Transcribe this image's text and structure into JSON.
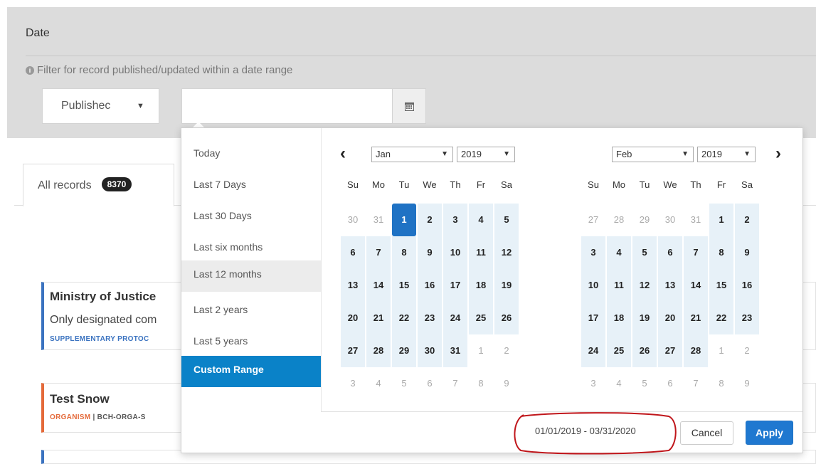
{
  "filter": {
    "title": "Date",
    "hint": "Filter for record published/updated within a date range",
    "type_select_value": "Publishec",
    "date_input_value": ""
  },
  "records": {
    "tab_all_label": "All records",
    "tab_all_count": "8370",
    "items": [
      {
        "title": "Ministry of Justice",
        "subtitle": "Only designated com",
        "tag": "SUPPLEMENTARY PROTOC"
      },
      {
        "title": "Test Snow",
        "tag_type": "ORGANISM",
        "tag_sep": " | ",
        "tag_rest": "BCH-ORGA-S"
      }
    ]
  },
  "picker": {
    "ranges": [
      "Today",
      "Last 7 Days",
      "Last 30 Days",
      "Last six months",
      "Last 12 months",
      "Last 2 years",
      "Last 5 years",
      "Custom Range"
    ],
    "hover_range": "Last 12 months",
    "active_range": "Custom Range",
    "dow": [
      "Su",
      "Mo",
      "Tu",
      "We",
      "Th",
      "Fr",
      "Sa"
    ],
    "left_month": "Jan",
    "left_year": "2019",
    "right_month": "Feb",
    "right_year": "2019",
    "left_days": [
      [
        "30",
        "31",
        "1",
        "2",
        "3",
        "4",
        "5"
      ],
      [
        "6",
        "7",
        "8",
        "9",
        "10",
        "11",
        "12"
      ],
      [
        "13",
        "14",
        "15",
        "16",
        "17",
        "18",
        "19"
      ],
      [
        "20",
        "21",
        "22",
        "23",
        "24",
        "25",
        "26"
      ],
      [
        "27",
        "28",
        "29",
        "30",
        "31",
        "1",
        "2"
      ],
      [
        "3",
        "4",
        "5",
        "6",
        "7",
        "8",
        "9"
      ]
    ],
    "right_days": [
      [
        "27",
        "28",
        "29",
        "30",
        "31",
        "1",
        "2"
      ],
      [
        "3",
        "4",
        "5",
        "6",
        "7",
        "8",
        "9"
      ],
      [
        "10",
        "11",
        "12",
        "13",
        "14",
        "15",
        "16"
      ],
      [
        "17",
        "18",
        "19",
        "20",
        "21",
        "22",
        "23"
      ],
      [
        "24",
        "25",
        "26",
        "27",
        "28",
        "1",
        "2"
      ],
      [
        "3",
        "4",
        "5",
        "6",
        "7",
        "8",
        "9"
      ]
    ],
    "range_text": "01/01/2019 - 03/31/2020",
    "cancel_label": "Cancel",
    "apply_label": "Apply",
    "prev_icon": "chevron-left-icon",
    "next_icon": "chevron-right-icon"
  },
  "colors": {
    "accent": "#1f78d0",
    "active_range": "#0a82c8",
    "in_range": "#e7f1f8",
    "annotation": "#c0161b"
  }
}
